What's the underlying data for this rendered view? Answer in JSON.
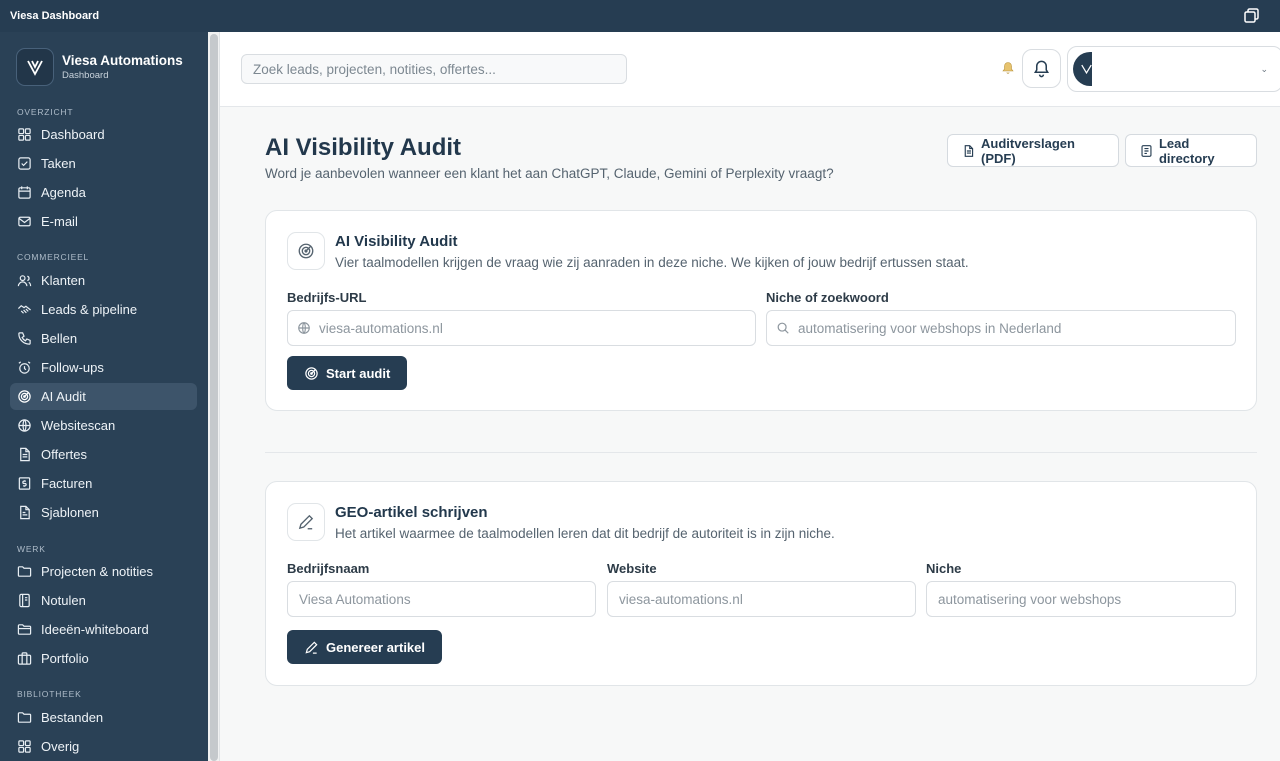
{
  "window": {
    "title": "Viesa Dashboard"
  },
  "brand": {
    "name": "Viesa Automations",
    "subtitle": "Dashboard"
  },
  "sidebar": {
    "sections": [
      {
        "label": "OVERZICHT",
        "items": [
          {
            "label": "Dashboard",
            "icon": "grid-icon"
          },
          {
            "label": "Taken",
            "icon": "check-square-icon"
          },
          {
            "label": "Agenda",
            "icon": "calendar-icon"
          },
          {
            "label": "E-mail",
            "icon": "mail-icon"
          }
        ]
      },
      {
        "label": "COMMERCIEEL",
        "items": [
          {
            "label": "Klanten",
            "icon": "users-icon"
          },
          {
            "label": "Leads & pipeline",
            "icon": "handshake-icon"
          },
          {
            "label": "Bellen",
            "icon": "phone-icon"
          },
          {
            "label": "Follow-ups",
            "icon": "alarm-clock-icon"
          },
          {
            "label": "AI Audit",
            "icon": "radar-icon",
            "active": true
          },
          {
            "label": "Websitescan",
            "icon": "globe-icon"
          },
          {
            "label": "Offertes",
            "icon": "file-icon"
          },
          {
            "label": "Facturen",
            "icon": "receipt-icon"
          },
          {
            "label": "Sjablonen",
            "icon": "template-icon"
          }
        ]
      },
      {
        "label": "WERK",
        "items": [
          {
            "label": "Projecten & notities",
            "icon": "folder-icon"
          },
          {
            "label": "Notulen",
            "icon": "notebook-icon"
          },
          {
            "label": "Ideeën-whiteboard",
            "icon": "folder-open-icon"
          },
          {
            "label": "Portfolio",
            "icon": "briefcase-icon"
          }
        ]
      },
      {
        "label": "BIBLIOTHEEK",
        "items": [
          {
            "label": "Bestanden",
            "icon": "folder-icon"
          },
          {
            "label": "Overig",
            "icon": "grid-icon"
          }
        ]
      }
    ]
  },
  "header": {
    "search_placeholder": "Zoek leads, projecten, notities, offertes...",
    "profile_chevron": "⌄"
  },
  "page": {
    "title": "AI Visibility Audit",
    "subtitle": "Word je aanbevolen wanneer een klant het aan ChatGPT, Claude, Gemini of Perplexity vraagt?",
    "buttons": {
      "reports": "Auditverslagen (PDF)",
      "leads": "Lead directory"
    }
  },
  "audit_card": {
    "title": "AI Visibility Audit",
    "description": "Vier taalmodellen krijgen de vraag wie zij aanraden in deze niche. We kijken of jouw bedrijf ertussen staat.",
    "url_label": "Bedrijfs-URL",
    "url_placeholder": "viesa-automations.nl",
    "niche_label": "Niche of zoekwoord",
    "niche_placeholder": "automatisering voor webshops in Nederland",
    "submit": "Start audit"
  },
  "geo_card": {
    "title": "GEO-artikel schrijven",
    "description": "Het artikel waarmee de taalmodellen leren dat dit bedrijf de autoriteit is in zijn niche.",
    "company_label": "Bedrijfsnaam",
    "company_placeholder": "Viesa Automations",
    "website_label": "Website",
    "website_placeholder": "viesa-automations.nl",
    "niche_label": "Niche",
    "niche_placeholder": "automatisering voor webshops",
    "submit": "Genereer artikel"
  },
  "colors": {
    "sidebar": "#2a4156",
    "titlebar": "#263d52",
    "accent": "#263d52",
    "active_nav": "#3d546a",
    "background": "#f7f8f8"
  }
}
